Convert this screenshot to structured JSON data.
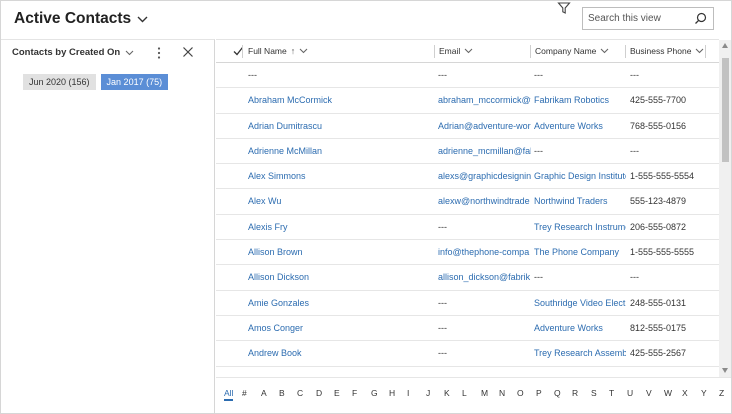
{
  "header": {
    "view_title": "Active Contacts",
    "search_placeholder": "Search this view"
  },
  "chart_pane": {
    "title": "Contacts by Created On",
    "chips": [
      {
        "label": "Jun 2020 (156)",
        "selected": false
      },
      {
        "label": "Jan 2017 (75)",
        "selected": true
      }
    ]
  },
  "grid": {
    "columns": [
      "Full Name",
      "Email",
      "Company Name",
      "Business Phone"
    ],
    "sort_indicator": "↑",
    "rows": [
      [
        "---",
        "---",
        "---",
        "---"
      ],
      [
        "Abraham McCormick",
        "abraham_mccormick@f",
        "Fabrikam Robotics",
        "425-555-7700"
      ],
      [
        "Adrian Dumitrascu",
        "Adrian@adventure-wor",
        "Adventure Works",
        "768-555-0156"
      ],
      [
        "Adrienne McMillan",
        "adrienne_mcmillan@fal",
        "---",
        "---"
      ],
      [
        "Alex Simmons",
        "alexs@graphicdesignin",
        "Graphic Design Institute",
        "1-555-555-5554"
      ],
      [
        "Alex Wu",
        "alexw@northwindtrade",
        "Northwind Traders",
        "555-123-4879"
      ],
      [
        "Alexis Fry",
        "---",
        "Trey Research Instrume",
        "206-555-0872"
      ],
      [
        "Allison Brown",
        "info@thephone-compa",
        "The Phone Company",
        "1-555-555-5555"
      ],
      [
        "Allison Dickson",
        "allison_dickson@fabrik",
        "---",
        "---"
      ],
      [
        "Amie Gonzales",
        "---",
        "Southridge Video Electr",
        "248-555-0131"
      ],
      [
        "Amos Conger",
        "---",
        "Adventure Works",
        "812-555-0175"
      ],
      [
        "Andrew Book",
        "---",
        "Trey Research Assembly",
        "425-555-2567"
      ]
    ]
  },
  "jump_bar": {
    "letters": [
      "All",
      "#",
      "A",
      "B",
      "C",
      "D",
      "E",
      "F",
      "G",
      "H",
      "I",
      "J",
      "K",
      "L",
      "M",
      "N",
      "O",
      "P",
      "Q",
      "R",
      "S",
      "T",
      "U",
      "V",
      "W",
      "X",
      "Y",
      "Z"
    ]
  },
  "colors": {
    "link": "#2c6cb0",
    "selected_chip": "#5b8ed6",
    "chip": "#e1e1e1"
  }
}
